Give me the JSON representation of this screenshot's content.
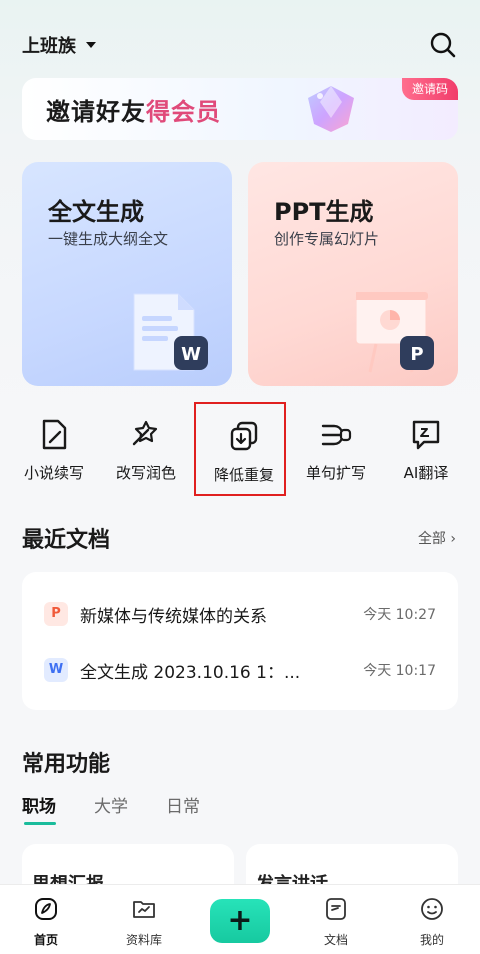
{
  "header": {
    "profile_name": "上班族"
  },
  "banner": {
    "text_part1": "邀请好友",
    "text_part2": "得会员",
    "badge": "邀请码"
  },
  "cards": [
    {
      "title": "全文生成",
      "subtitle": "一键生成大纲全文",
      "badge_letter": "W"
    },
    {
      "title": "PPT生成",
      "subtitle": "创作专属幻灯片",
      "badge_letter": "P"
    }
  ],
  "tools": [
    {
      "label": "小说续写",
      "icon": "novel-continue-icon"
    },
    {
      "label": "改写润色",
      "icon": "rewrite-polish-icon"
    },
    {
      "label": "降低重复",
      "icon": "reduce-duplicate-icon"
    },
    {
      "label": "单句扩写",
      "icon": "sentence-expand-icon"
    },
    {
      "label": "AI翻译",
      "icon": "ai-translate-icon"
    }
  ],
  "recent": {
    "title": "最近文档",
    "more_label": "全部",
    "docs": [
      {
        "type_letter": "P",
        "name": "新媒体与传统媒体的关系",
        "time": "今天 10:27",
        "color": "#f05a3a"
      },
      {
        "type_letter": "W",
        "name": "全文生成 2023.10.16 1：...",
        "time": "今天 10:17",
        "color": "#3d6ff2"
      }
    ]
  },
  "common": {
    "title": "常用功能",
    "tabs": [
      "职场",
      "大学",
      "日常"
    ],
    "cards": [
      "思想汇报",
      "发言讲话"
    ]
  },
  "nav": [
    {
      "label": "首页",
      "icon": "home-icon"
    },
    {
      "label": "资料库",
      "icon": "library-icon"
    },
    {
      "label": "",
      "icon": "plus-icon"
    },
    {
      "label": "文档",
      "icon": "document-icon"
    },
    {
      "label": "我的",
      "icon": "profile-icon"
    }
  ],
  "colors": {
    "accent": "#1abc9c",
    "highlight_border": "#e02020",
    "badge_pink": "#f13c6a"
  }
}
